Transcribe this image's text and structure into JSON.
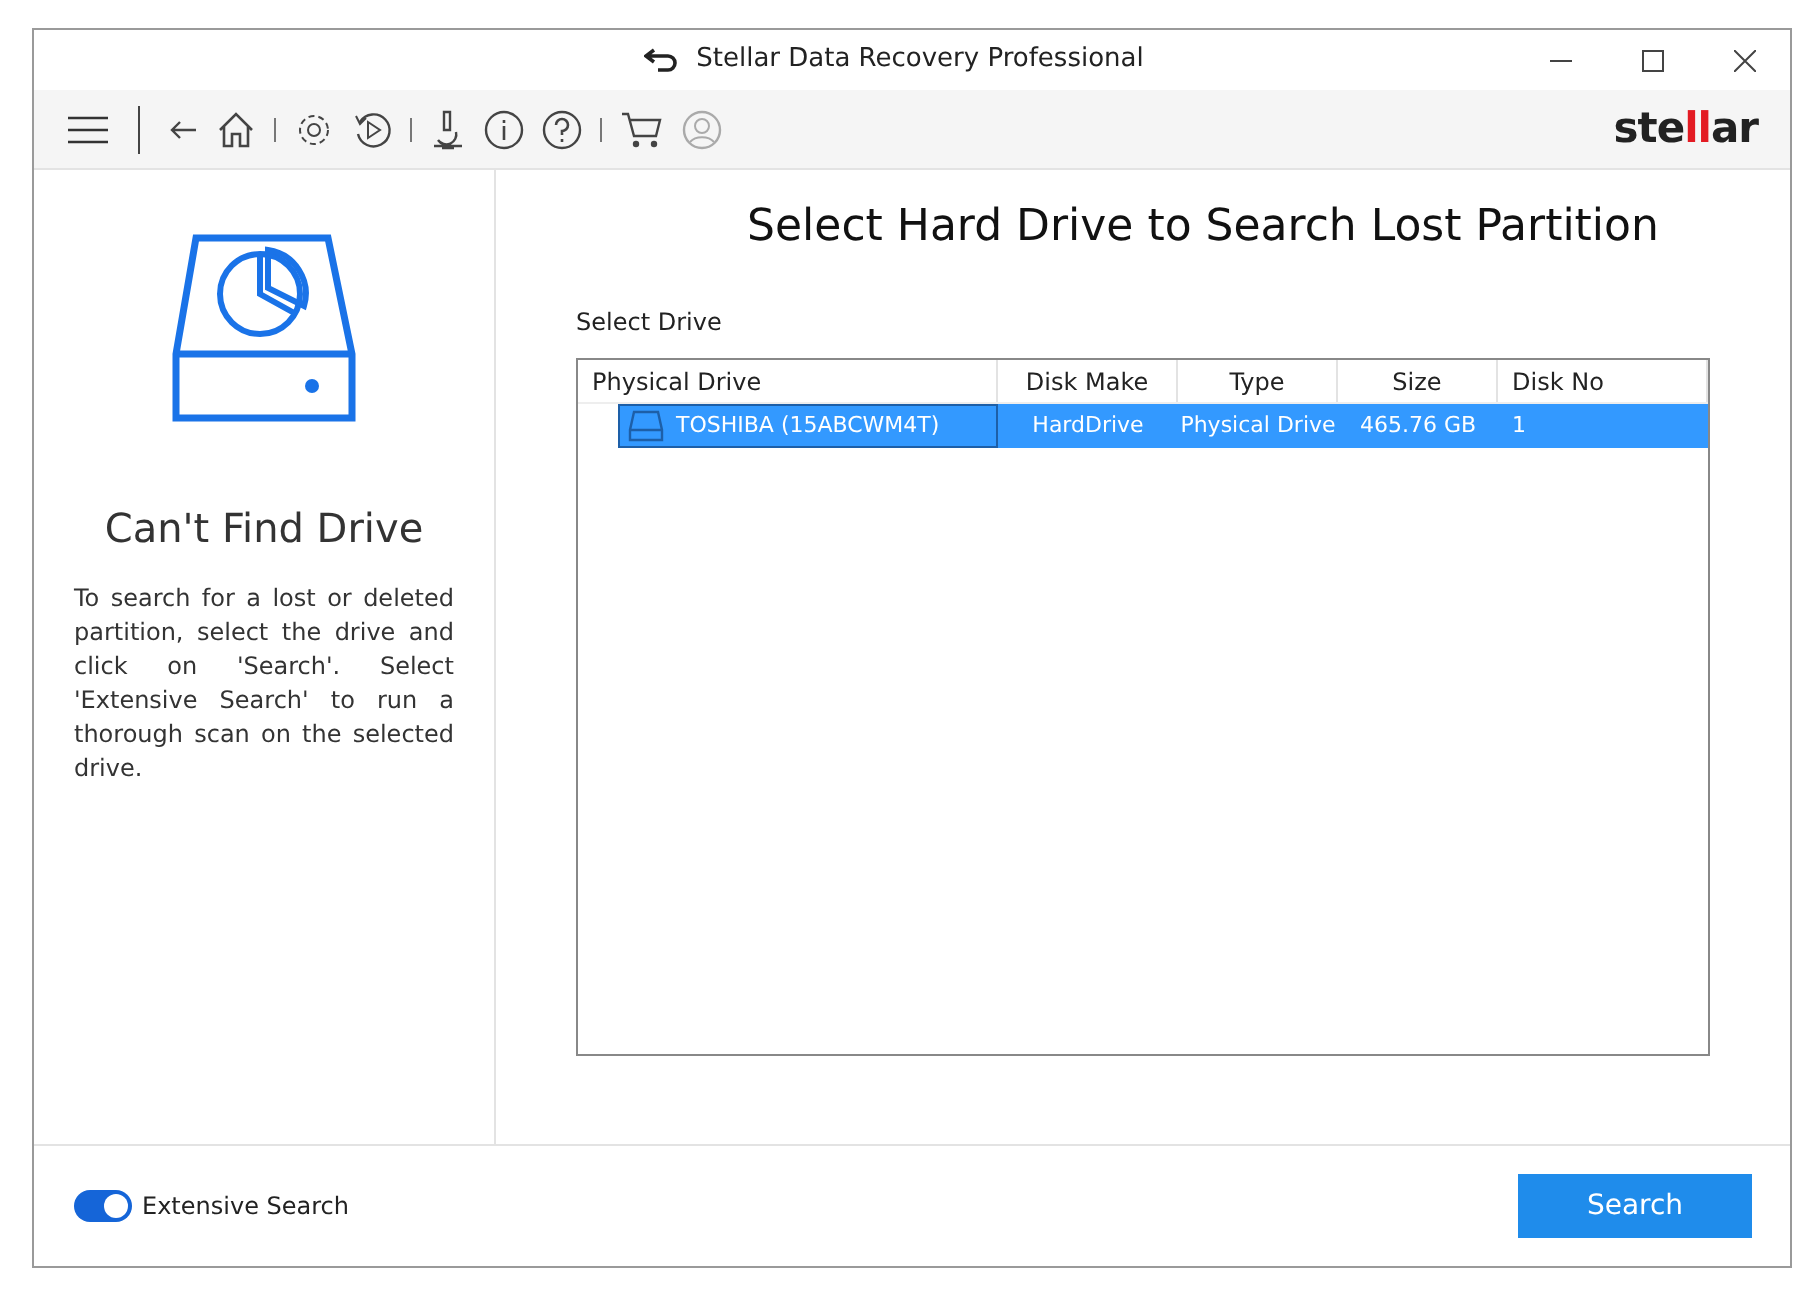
{
  "window": {
    "title": "Stellar Data Recovery Professional"
  },
  "logo": "stellar",
  "sidebar": {
    "title": "Can't Find Drive",
    "description": "To search for a lost or deleted partition, select the drive and click on 'Search'. Select 'Extensive Search' to run a thorough scan on the selected drive."
  },
  "main": {
    "heading": "Select Hard Drive to Search Lost Partition",
    "section_label": "Select Drive",
    "table": {
      "columns": [
        "Physical Drive",
        "Disk Make",
        "Type",
        "Size",
        "Disk No"
      ],
      "rows": [
        {
          "selected": true,
          "cells": [
            "TOSHIBA (15ABCWM4T)",
            "HardDrive",
            "Physical Drive",
            "465.76 GB",
            "1"
          ]
        }
      ]
    }
  },
  "footer": {
    "toggle": {
      "label": "Extensive Search",
      "on": true
    },
    "button": "Search"
  }
}
